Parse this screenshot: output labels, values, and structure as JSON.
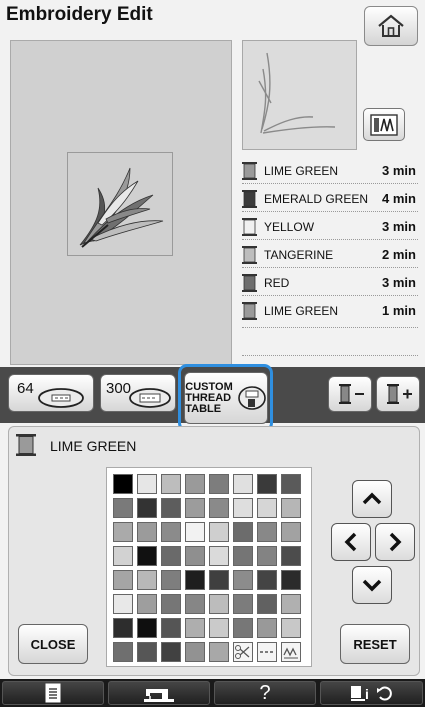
{
  "title": "Embroidery Edit",
  "home_icon": "home-icon",
  "thread_display_icon": "thread-spool-display-icon",
  "threads": [
    {
      "name": "LIME GREEN",
      "time": "3 min",
      "color": "#9a9a9a"
    },
    {
      "name": "EMERALD GREEN",
      "time": "4 min",
      "color": "#3c3c3c"
    },
    {
      "name": "YELLOW",
      "time": "3 min",
      "color": "#f0f0f0"
    },
    {
      "name": "TANGERINE",
      "time": "2 min",
      "color": "#bdbdbd"
    },
    {
      "name": "RED",
      "time": "3 min",
      "color": "#6e6e6e"
    },
    {
      "name": "LIME GREEN",
      "time": "1 min",
      "color": "#9a9a9a"
    }
  ],
  "toolbar": {
    "btn64": "64",
    "btn300": "300",
    "custom_line1": "CUSTOM",
    "custom_line2": "THREAD",
    "custom_line3": "TABLE",
    "highlight_color": "#2f8fe0"
  },
  "selected_thread": "LIME GREEN",
  "palette": [
    [
      "#000000",
      "#e6e6e6",
      "#bdbdbd",
      "#9a9a9a",
      "#7d7d7d",
      "#e0e0e0",
      "#3a3a3a",
      "#5a5a5a"
    ],
    [
      "#7a7a7a",
      "#333333",
      "#5d5d5d",
      "#9c9c9c",
      "#8a8a8a",
      "#dedede",
      "#d6d6d6",
      "#b6b6b6"
    ],
    [
      "#aaaaaa",
      "#9b9b9b",
      "#8b8b8b",
      "#f2f2f2",
      "#cfcfcf",
      "#6c6c6c",
      "#888888",
      "#a2a2a2"
    ],
    [
      "#d2d2d2",
      "#111111",
      "#6a6a6a",
      "#8f8f8f",
      "#dadada",
      "#757575",
      "#838383",
      "#4c4c4c"
    ],
    [
      "#a5a5a5",
      "#b8b8b8",
      "#7e7e7e",
      "#1e1e1e",
      "#3f3f3f",
      "#8c8c8c",
      "#444444",
      "#2b2b2b"
    ],
    [
      "#e8e8e8",
      "#9e9e9e",
      "#767676",
      "#868686",
      "#bcbcbc",
      "#7c7c7c",
      "#616161",
      "#b0b0b0"
    ],
    [
      "#2d2d2d",
      "#0f0f0f",
      "#555555",
      "#aeaeae",
      "#cacaca",
      "#777777",
      "#999999",
      "#c8c8c8"
    ],
    [
      "#6f6f6f",
      "#565656",
      "#414141",
      "#929292",
      "#a8a8a8",
      "scissors",
      "dashes",
      "stitch"
    ]
  ],
  "close_label": "CLOSE",
  "reset_label": "RESET",
  "bottom": {
    "help_label": "?"
  }
}
